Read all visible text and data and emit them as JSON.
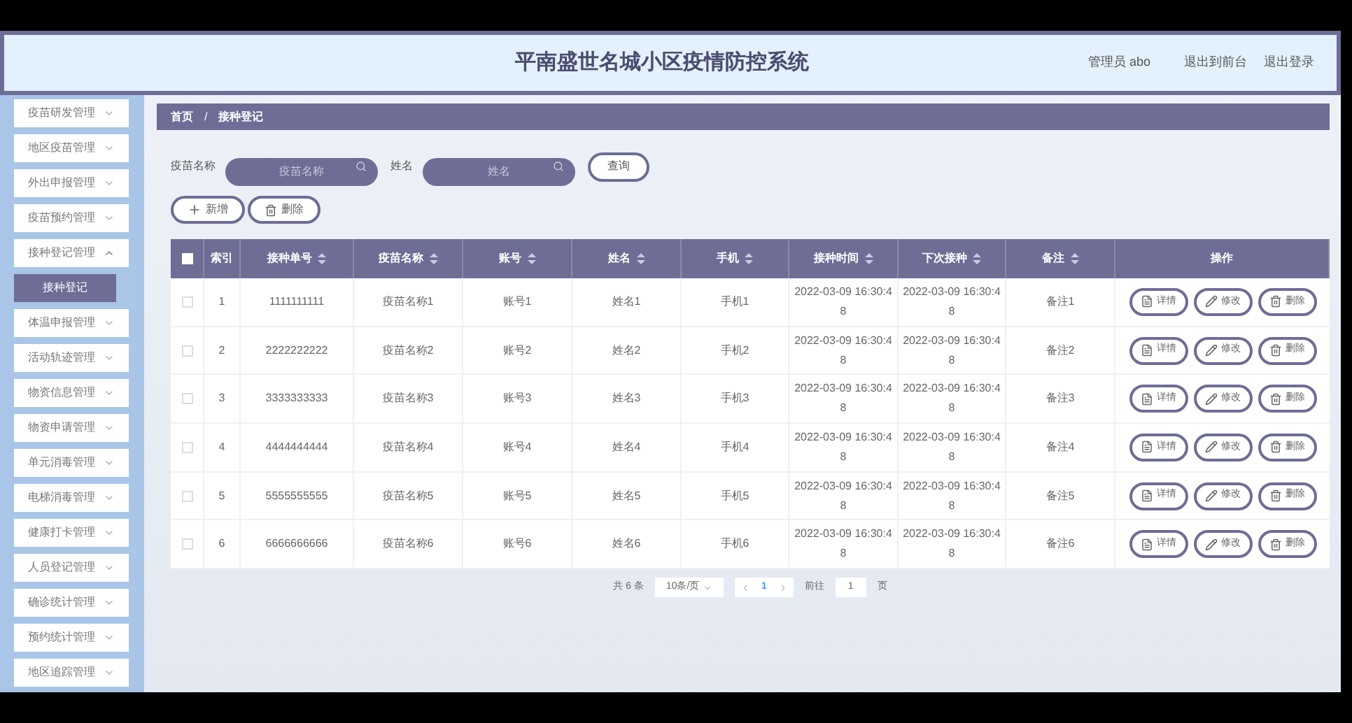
{
  "header": {
    "title": "平南盛世名城小区疫情防控系统",
    "user": "管理员 abo",
    "links": [
      "退出到前台",
      "退出登录"
    ]
  },
  "sidebar": {
    "items": [
      {
        "label": "疫苗研发管理",
        "expanded": false
      },
      {
        "label": "地区疫苗管理",
        "expanded": false
      },
      {
        "label": "外出申报管理",
        "expanded": false
      },
      {
        "label": "疫苗预约管理",
        "expanded": false
      },
      {
        "label": "接种登记管理",
        "expanded": true,
        "children": [
          {
            "label": "接种登记",
            "selected": true
          }
        ]
      },
      {
        "label": "体温申报管理",
        "expanded": false
      },
      {
        "label": "活动轨迹管理",
        "expanded": false
      },
      {
        "label": "物资信息管理",
        "expanded": false
      },
      {
        "label": "物资申请管理",
        "expanded": false
      },
      {
        "label": "单元消毒管理",
        "expanded": false
      },
      {
        "label": "电梯消毒管理",
        "expanded": false
      },
      {
        "label": "健康打卡管理",
        "expanded": false
      },
      {
        "label": "人员登记管理",
        "expanded": false
      },
      {
        "label": "确诊统计管理",
        "expanded": false
      },
      {
        "label": "预约统计管理",
        "expanded": false
      },
      {
        "label": "地区追踪管理",
        "expanded": false
      }
    ]
  },
  "breadcrumb": {
    "items": [
      "首页",
      "接种登记"
    ],
    "separator": "/"
  },
  "search": {
    "fields": [
      {
        "label": "疫苗名称",
        "placeholder": "疫苗名称"
      },
      {
        "label": "姓名",
        "placeholder": "姓名"
      }
    ],
    "button": "查询"
  },
  "actions": [
    {
      "kind": "add",
      "label": "新增"
    },
    {
      "kind": "delete",
      "label": "删除"
    }
  ],
  "table": {
    "select_all": {
      "checked": false
    },
    "columns": [
      {
        "label": "索引",
        "sortable": false
      },
      {
        "label": "接种单号",
        "sortable": true
      },
      {
        "label": "疫苗名称",
        "sortable": true
      },
      {
        "label": "账号",
        "sortable": true
      },
      {
        "label": "姓名",
        "sortable": true
      },
      {
        "label": "手机",
        "sortable": true
      },
      {
        "label": "接种时间",
        "sortable": true
      },
      {
        "label": "下次接种",
        "sortable": true
      },
      {
        "label": "备注",
        "sortable": true
      },
      {
        "label": "操作",
        "sortable": false
      }
    ],
    "rows": [
      {
        "checked": false,
        "cells": [
          "1",
          "1111111111",
          "疫苗名称1",
          "账号1",
          "姓名1",
          "手机1",
          "2022-03-09 16:30:48",
          "2022-03-09 16:30:48",
          "备注1"
        ],
        "actions": [
          {
            "kind": "detail",
            "label": "详情"
          },
          {
            "kind": "edit",
            "label": "修改"
          },
          {
            "kind": "delete",
            "label": "删除"
          }
        ]
      },
      {
        "checked": false,
        "cells": [
          "2",
          "2222222222",
          "疫苗名称2",
          "账号2",
          "姓名2",
          "手机2",
          "2022-03-09 16:30:48",
          "2022-03-09 16:30:48",
          "备注2"
        ],
        "actions": [
          {
            "kind": "detail",
            "label": "详情"
          },
          {
            "kind": "edit",
            "label": "修改"
          },
          {
            "kind": "delete",
            "label": "删除"
          }
        ]
      },
      {
        "checked": false,
        "cells": [
          "3",
          "3333333333",
          "疫苗名称3",
          "账号3",
          "姓名3",
          "手机3",
          "2022-03-09 16:30:48",
          "2022-03-09 16:30:48",
          "备注3"
        ],
        "actions": [
          {
            "kind": "detail",
            "label": "详情"
          },
          {
            "kind": "edit",
            "label": "修改"
          },
          {
            "kind": "delete",
            "label": "删除"
          }
        ]
      },
      {
        "checked": false,
        "cells": [
          "4",
          "4444444444",
          "疫苗名称4",
          "账号4",
          "姓名4",
          "手机4",
          "2022-03-09 16:30:48",
          "2022-03-09 16:30:48",
          "备注4"
        ],
        "actions": [
          {
            "kind": "detail",
            "label": "详情"
          },
          {
            "kind": "edit",
            "label": "修改"
          },
          {
            "kind": "delete",
            "label": "删除"
          }
        ]
      },
      {
        "checked": false,
        "cells": [
          "5",
          "5555555555",
          "疫苗名称5",
          "账号5",
          "姓名5",
          "手机5",
          "2022-03-09 16:30:48",
          "2022-03-09 16:30:48",
          "备注5"
        ],
        "actions": [
          {
            "kind": "detail",
            "label": "详情"
          },
          {
            "kind": "edit",
            "label": "修改"
          },
          {
            "kind": "delete",
            "label": "删除"
          }
        ]
      },
      {
        "checked": false,
        "cells": [
          "6",
          "6666666666",
          "疫苗名称6",
          "账号6",
          "姓名6",
          "手机6",
          "2022-03-09 16:30:48",
          "2022-03-09 16:30:48",
          "备注6"
        ],
        "actions": [
          {
            "kind": "detail",
            "label": "详情"
          },
          {
            "kind": "edit",
            "label": "修改"
          },
          {
            "kind": "delete",
            "label": "删除"
          }
        ]
      }
    ]
  },
  "pagination": {
    "total": "共 6 条",
    "page_size": "10条/页",
    "pages": [
      {
        "label": "1",
        "selected": true
      }
    ],
    "goto_label": "前往",
    "goto_value": "1",
    "goto_suffix": "页"
  }
}
